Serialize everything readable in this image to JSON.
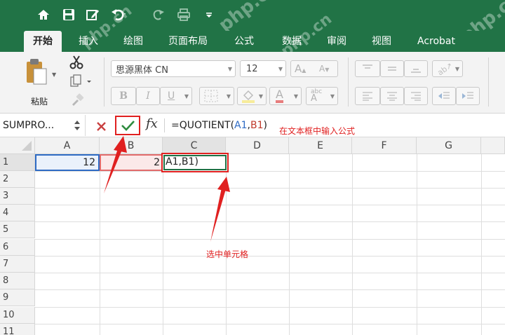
{
  "quick_access": {
    "icons": [
      "home-icon",
      "save-icon",
      "edit-icon",
      "undo-icon",
      "redo-icon",
      "print-icon",
      "customize-icon"
    ]
  },
  "tabs": [
    {
      "label": "开始",
      "active": true
    },
    {
      "label": "插入"
    },
    {
      "label": "绘图"
    },
    {
      "label": "页面布局"
    },
    {
      "label": "公式"
    },
    {
      "label": "数据"
    },
    {
      "label": "审阅"
    },
    {
      "label": "视图"
    },
    {
      "label": "Acrobat"
    }
  ],
  "ribbon": {
    "paste_label": "粘贴",
    "font_name": "思源黑体 CN",
    "font_size": "12",
    "grow_font": "A",
    "shrink_font": "A",
    "bold": "B",
    "italic": "I",
    "underline": "U",
    "font_color_letter": "A",
    "phonetic_label": "abc",
    "phonetic_letter": "A"
  },
  "formula_bar": {
    "name_box": "SUMPRO...",
    "fx_label": "fx",
    "formula_prefix": "=QUOTIENT(",
    "formula_arg1": "A1",
    "formula_comma": ",",
    "formula_arg2": "B1",
    "formula_suffix": ")"
  },
  "sheet": {
    "columns": [
      "A",
      "B",
      "C",
      "D",
      "E",
      "F",
      "G"
    ],
    "rows": [
      "1",
      "2",
      "3",
      "4",
      "5",
      "6",
      "7",
      "8",
      "9",
      "10",
      "11"
    ],
    "cells": {
      "A1": "12",
      "B1": "2",
      "C1": "A1,B1)"
    }
  },
  "annotations": {
    "textbox_note": "在文本框中输入公式",
    "cell_note": "选中单元格"
  },
  "watermark_text": "php.cn",
  "colors": {
    "excel_green": "#217346",
    "annotation_red": "#e02020",
    "ref_blue": "#2e6bc4",
    "ref_red": "#c0392b",
    "confirm_green": "#2e8b3e"
  }
}
